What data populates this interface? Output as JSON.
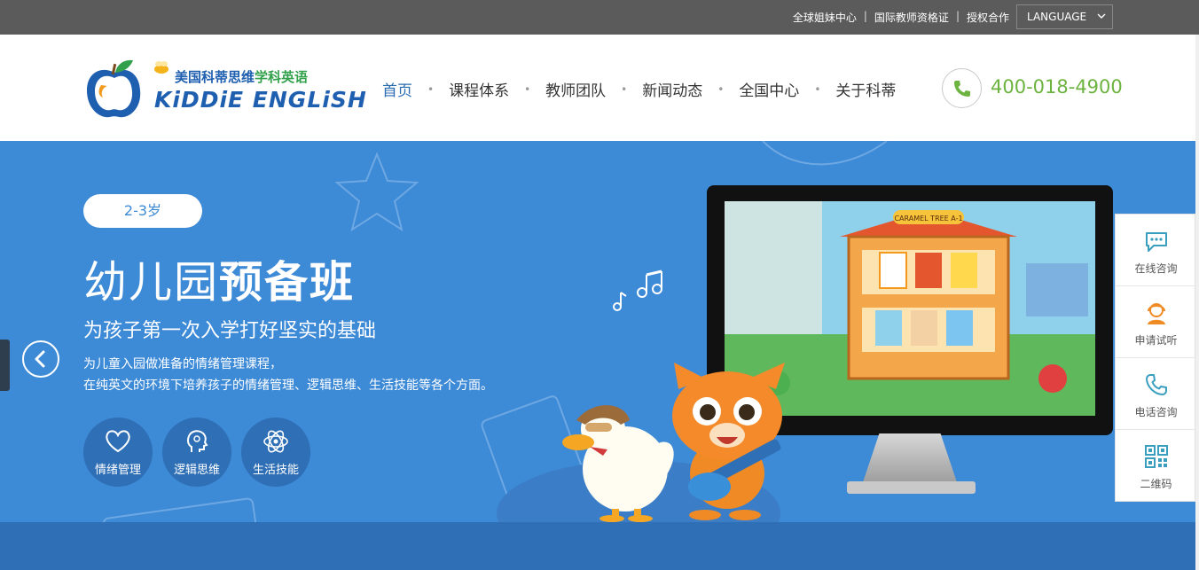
{
  "topbar": {
    "links": [
      "全球姐妹中心",
      "国际教师资格证",
      "授权合作"
    ],
    "separator": "|",
    "language": "LANGUAGE"
  },
  "header": {
    "logo_cn_blue": "美国科蒂思维",
    "logo_cn_green": "学科英语",
    "logo_en": "KiDDiE ENGLiSH",
    "nav": [
      "首页",
      "课程体系",
      "教师团队",
      "新闻动态",
      "全国中心",
      "关于科蒂"
    ],
    "nav_active_index": 0,
    "phone": "400-018-4900"
  },
  "hero": {
    "age": "2-3岁",
    "title_normal": "幼儿园",
    "title_bold": "预备班",
    "subtitle": "为孩子第一次入学打好坚实的基础",
    "desc_line1": "为儿童入园做准备的情绪管理课程，",
    "desc_line2": "在纯英文的环境下培养孩子的情绪管理、逻辑思维、生活技能等各个方面。",
    "features": [
      "情绪管理",
      "逻辑思维",
      "生活技能"
    ],
    "screen_sign": "CARAMEL TREE A-1"
  },
  "float_panel": [
    "在线咨询",
    "申请试听",
    "电话咨询",
    "二维码"
  ],
  "colors": {
    "hero_blue": "#3d8ad7",
    "phone_green": "#6cb33f",
    "nav_active": "#2b6cb0",
    "float_icon": "#3a9fbf"
  }
}
